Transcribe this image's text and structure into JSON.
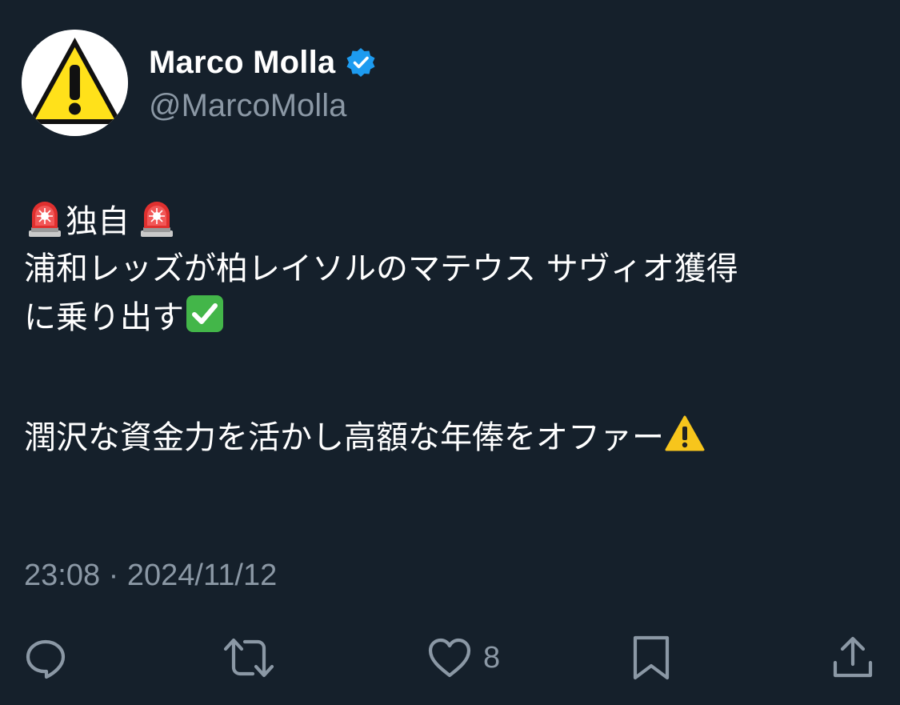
{
  "author": {
    "display_name": "Marco Molla",
    "handle": "@MarcoMolla",
    "verified": true,
    "avatar_icon": "warning-sign-icon"
  },
  "tweet": {
    "line1_text": "独自",
    "line2_text": "浦和レッズが柏レイソルのマテウス サヴィオ獲得",
    "line3_text": "に乗り出す",
    "line5_text": "潤沢な資金力を活かし高額な年俸をオファー",
    "emojis": [
      "police-light-icon",
      "police-light-icon",
      "check-mark-button-icon",
      "warning-icon"
    ],
    "timestamp": "23:08 · 2024/11/12"
  },
  "actions": {
    "reply_icon": "reply-icon",
    "retweet_icon": "retweet-icon",
    "like_icon": "heart-icon",
    "like_count": "8",
    "bookmark_icon": "bookmark-icon",
    "share_icon": "share-icon"
  },
  "colors": {
    "background": "#15202b",
    "secondary_text": "#8b98a5",
    "verified_blue": "#1d9bf0"
  }
}
